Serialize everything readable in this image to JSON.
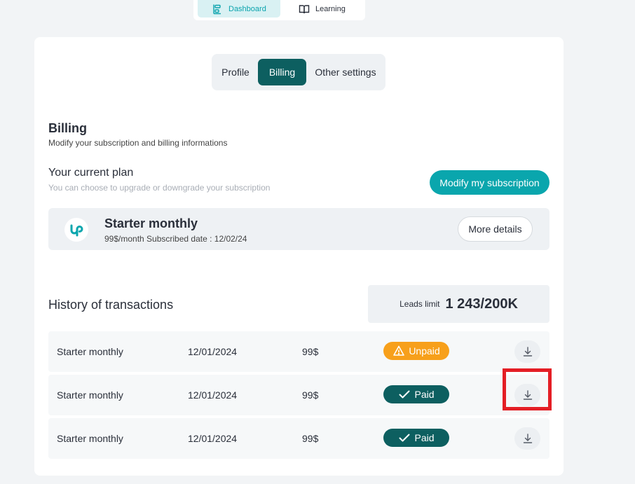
{
  "nav": {
    "dashboard_label": "Dashboard",
    "learning_label": "Learning"
  },
  "tabs": [
    {
      "label": "Profile"
    },
    {
      "label": "Billing"
    },
    {
      "label": "Other settings"
    }
  ],
  "billing": {
    "title": "Billing",
    "subtitle": "Modify your subscription and billing informations"
  },
  "plan": {
    "title": "Your current plan",
    "subtitle": "You can choose to upgrade or downgrade your subscription",
    "modify_button": "Modify my subscription",
    "name": "Starter monthly",
    "meta": "99$/month Subscribed date : 12/02/24",
    "details_button": "More details"
  },
  "history": {
    "title": "History of transactions",
    "leads_label": "Leads limit",
    "leads_value": "1 243/200K",
    "rows": [
      {
        "name": "Starter monthly",
        "date": "12/01/2024",
        "amount": "99$",
        "status": "Unpaid"
      },
      {
        "name": "Starter monthly",
        "date": "12/01/2024",
        "amount": "99$",
        "status": "Paid"
      },
      {
        "name": "Starter monthly",
        "date": "12/01/2024",
        "amount": "99$",
        "status": "Paid"
      }
    ]
  },
  "colors": {
    "accent": "#0aa6ad",
    "dark_teal": "#0d5f60",
    "unpaid": "#f7a01b",
    "highlight": "#e41e25"
  }
}
